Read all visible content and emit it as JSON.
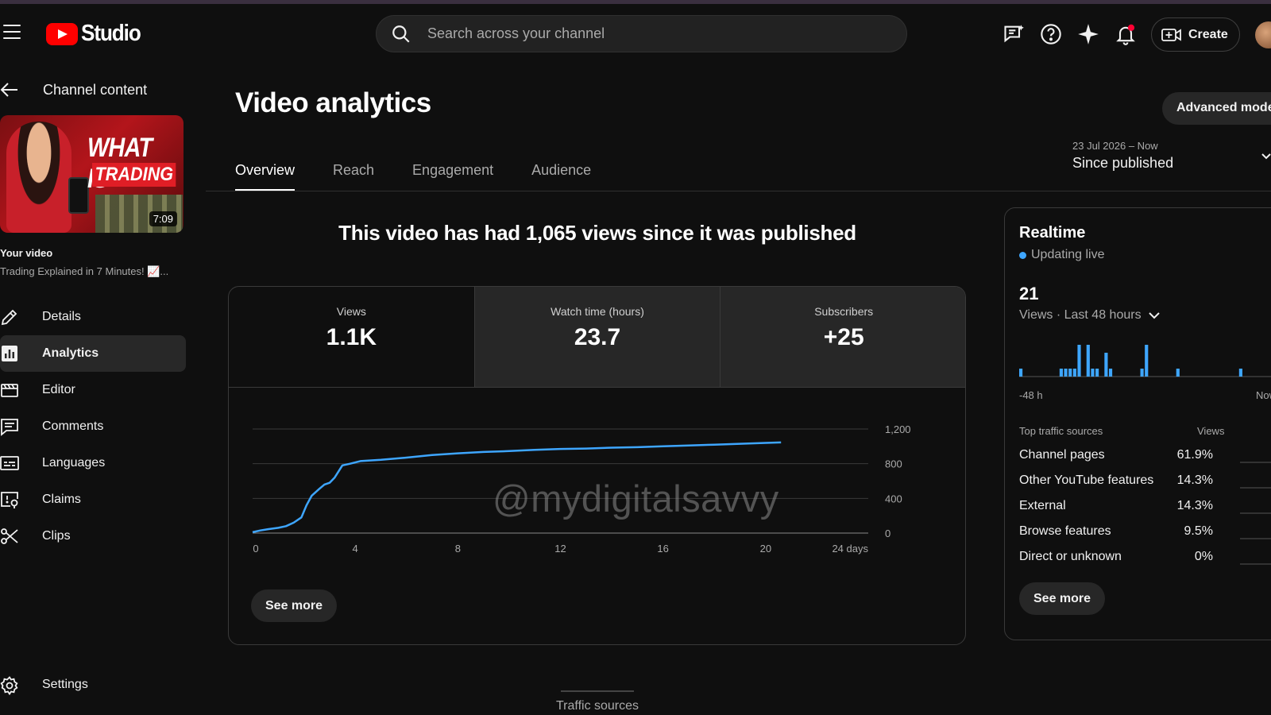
{
  "header": {
    "logo_text": "Studio",
    "search_placeholder": "Search across your channel",
    "create_label": "Create",
    "icons": [
      "menu-icon",
      "search-icon",
      "feedback-icon",
      "help-icon",
      "sparkle-icon",
      "notification-icon",
      "create-video-icon"
    ]
  },
  "sidebar": {
    "back_label": "Channel content",
    "thumbnail": {
      "title_line1": "WHAT IS",
      "title_line2": "TRADING",
      "duration": "7:09"
    },
    "your_video_label": "Your video",
    "video_title": "Trading Explained in 7 Minutes! 📈...",
    "items": [
      {
        "label": "Details",
        "icon": "pencil-icon",
        "active": false
      },
      {
        "label": "Analytics",
        "icon": "analytics-icon",
        "active": true
      },
      {
        "label": "Editor",
        "icon": "editor-icon",
        "active": false
      },
      {
        "label": "Comments",
        "icon": "comments-icon",
        "active": false
      },
      {
        "label": "Languages",
        "icon": "subtitles-icon",
        "active": false
      },
      {
        "label": "Claims",
        "icon": "claims-icon",
        "active": false
      },
      {
        "label": "Clips",
        "icon": "scissors-icon",
        "active": false
      }
    ],
    "settings_label": "Settings"
  },
  "main": {
    "title": "Video analytics",
    "advanced_mode_label": "Advanced mode",
    "date_range": {
      "small": "23 Jul 2026 – Now",
      "main": "Since published"
    },
    "tabs": [
      {
        "label": "Overview",
        "active": true
      },
      {
        "label": "Reach",
        "active": false
      },
      {
        "label": "Engagement",
        "active": false
      },
      {
        "label": "Audience",
        "active": false
      }
    ],
    "headline": "This video has had 1,065 views since it was published",
    "metrics": [
      {
        "label": "Views",
        "value": "1.1K"
      },
      {
        "label": "Watch time (hours)",
        "value": "23.7"
      },
      {
        "label": "Subscribers",
        "value": "+25"
      }
    ],
    "see_more_label": "See more",
    "watermark": "@mydigitalsavvy",
    "next_section_label": "Traffic sources"
  },
  "chart_data": {
    "type": "line",
    "title": "",
    "xlabel": "",
    "ylabel": "",
    "x_ticks": [
      "0",
      "4",
      "8",
      "12",
      "16",
      "20",
      "24 days"
    ],
    "y_ticks": [
      "0",
      "400",
      "800",
      "1,200"
    ],
    "xlim": [
      0,
      24
    ],
    "ylim": [
      0,
      1200
    ],
    "grid": true,
    "line_color": "#3ea6ff",
    "series": [
      {
        "x": [
          0,
          0.3,
          0.6,
          1,
          1.3,
          1.6,
          1.9,
          2.1,
          2.3,
          2.6,
          2.8,
          3.0,
          3.2,
          3.5,
          3.8,
          4.2,
          5,
          6,
          7,
          8,
          9,
          10,
          11,
          12,
          13,
          14,
          15,
          16,
          17,
          18,
          19,
          20,
          20.6
        ],
        "y": [
          10,
          30,
          45,
          60,
          80,
          120,
          180,
          320,
          430,
          510,
          560,
          580,
          640,
          780,
          800,
          830,
          845,
          870,
          900,
          920,
          935,
          945,
          960,
          970,
          975,
          985,
          990,
          1000,
          1010,
          1020,
          1030,
          1040,
          1045
        ]
      }
    ]
  },
  "realtime": {
    "title": "Realtime",
    "live_label": "Updating live",
    "value": "21",
    "sub_label": "Views · Last 48 hours",
    "axis_left": "-48 h",
    "axis_right": "Now",
    "bar_color": "#3ea6ff",
    "bars": [
      1,
      0,
      0,
      0,
      0,
      0,
      0,
      0,
      0,
      1,
      1,
      1,
      1,
      4,
      0,
      4,
      1,
      1,
      0,
      3,
      1,
      0,
      0,
      0,
      0,
      0,
      0,
      1,
      4,
      0,
      0,
      0,
      0,
      0,
      0,
      1,
      0,
      0,
      0,
      0,
      0,
      0,
      0,
      0,
      0,
      0,
      0,
      0,
      0,
      1,
      0,
      0,
      0,
      0,
      0,
      0,
      0
    ],
    "traffic_header": "Top traffic sources",
    "views_header": "Views",
    "sources": [
      {
        "label": "Channel pages",
        "pct": "61.9%"
      },
      {
        "label": "Other YouTube features",
        "pct": "14.3%"
      },
      {
        "label": "External",
        "pct": "14.3%"
      },
      {
        "label": "Browse features",
        "pct": "9.5%"
      },
      {
        "label": "Direct or unknown",
        "pct": "0%"
      }
    ],
    "see_more_label": "See more"
  }
}
